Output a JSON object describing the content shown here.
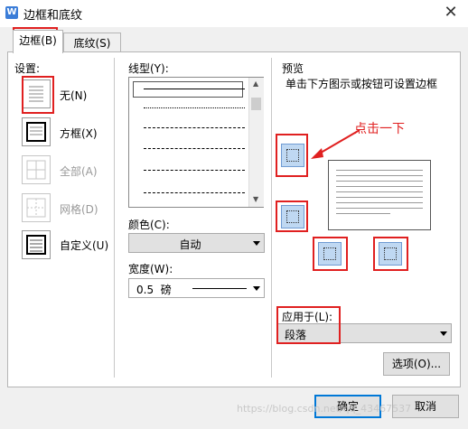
{
  "window": {
    "title": "边框和底纹",
    "close_glyph": "✕",
    "icon": "app-w-icon"
  },
  "tabs": [
    {
      "label": "边框(B)",
      "selected": true
    },
    {
      "label": "底纹(S)",
      "selected": false
    }
  ],
  "setting": {
    "label": "设置:",
    "options": [
      {
        "label": "无(N)",
        "enabled": true
      },
      {
        "label": "方框(X)",
        "enabled": true
      },
      {
        "label": "全部(A)",
        "enabled": false
      },
      {
        "label": "网格(D)",
        "enabled": false
      },
      {
        "label": "自定义(U)",
        "enabled": true
      }
    ]
  },
  "line_style": {
    "label": "线型(Y):"
  },
  "color": {
    "label": "颜色(C):",
    "value": "自动"
  },
  "width": {
    "label": "宽度(W):",
    "value": "0.5  磅"
  },
  "preview": {
    "label": "预览",
    "hint": "单击下方图示或按钮可设置边框",
    "annotation": "点击一下"
  },
  "apply_to": {
    "label": "应用于(L):",
    "value": "段落"
  },
  "buttons": {
    "options": "选项(O)...",
    "ok": "确定",
    "cancel": "取消"
  },
  "watermark": "https://blog.csdn.net/qq_43467537",
  "colors": {
    "annotation_red": "#e02020",
    "border_icon_blue": "#bfd8f2"
  }
}
